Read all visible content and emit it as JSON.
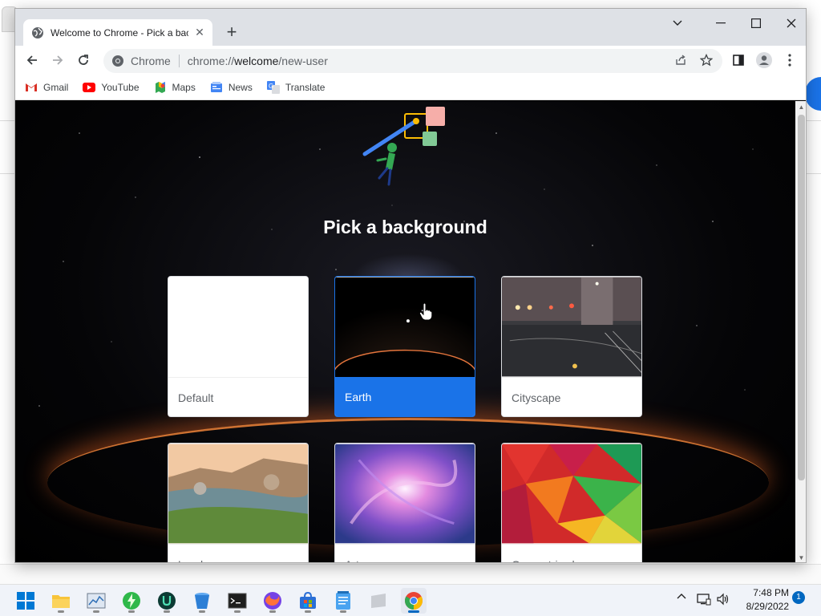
{
  "browser": {
    "tab_title": "Welcome to Chrome - Pick a bac",
    "omnibox": {
      "site_label": "Chrome",
      "url_scheme": "chrome://",
      "url_host": "welcome",
      "url_path": "/new-user"
    },
    "bookmarks": [
      {
        "label": "Gmail",
        "icon": "gmail-icon"
      },
      {
        "label": "YouTube",
        "icon": "youtube-icon"
      },
      {
        "label": "Maps",
        "icon": "maps-icon"
      },
      {
        "label": "News",
        "icon": "news-icon"
      },
      {
        "label": "Translate",
        "icon": "translate-icon"
      }
    ]
  },
  "page": {
    "heading": "Pick a background",
    "backgrounds": [
      {
        "label": "Default",
        "selected": false
      },
      {
        "label": "Earth",
        "selected": true
      },
      {
        "label": "Cityscape",
        "selected": false
      },
      {
        "label": "Landscape",
        "selected": false
      },
      {
        "label": "Art",
        "selected": false
      },
      {
        "label": "Geometric shapes",
        "selected": false
      }
    ]
  },
  "taskbar": {
    "time": "7:48 PM",
    "date": "8/29/2022",
    "notifications": "1"
  },
  "colors": {
    "accent": "#1a73e8",
    "taskbar_accent": "#0067c0"
  }
}
